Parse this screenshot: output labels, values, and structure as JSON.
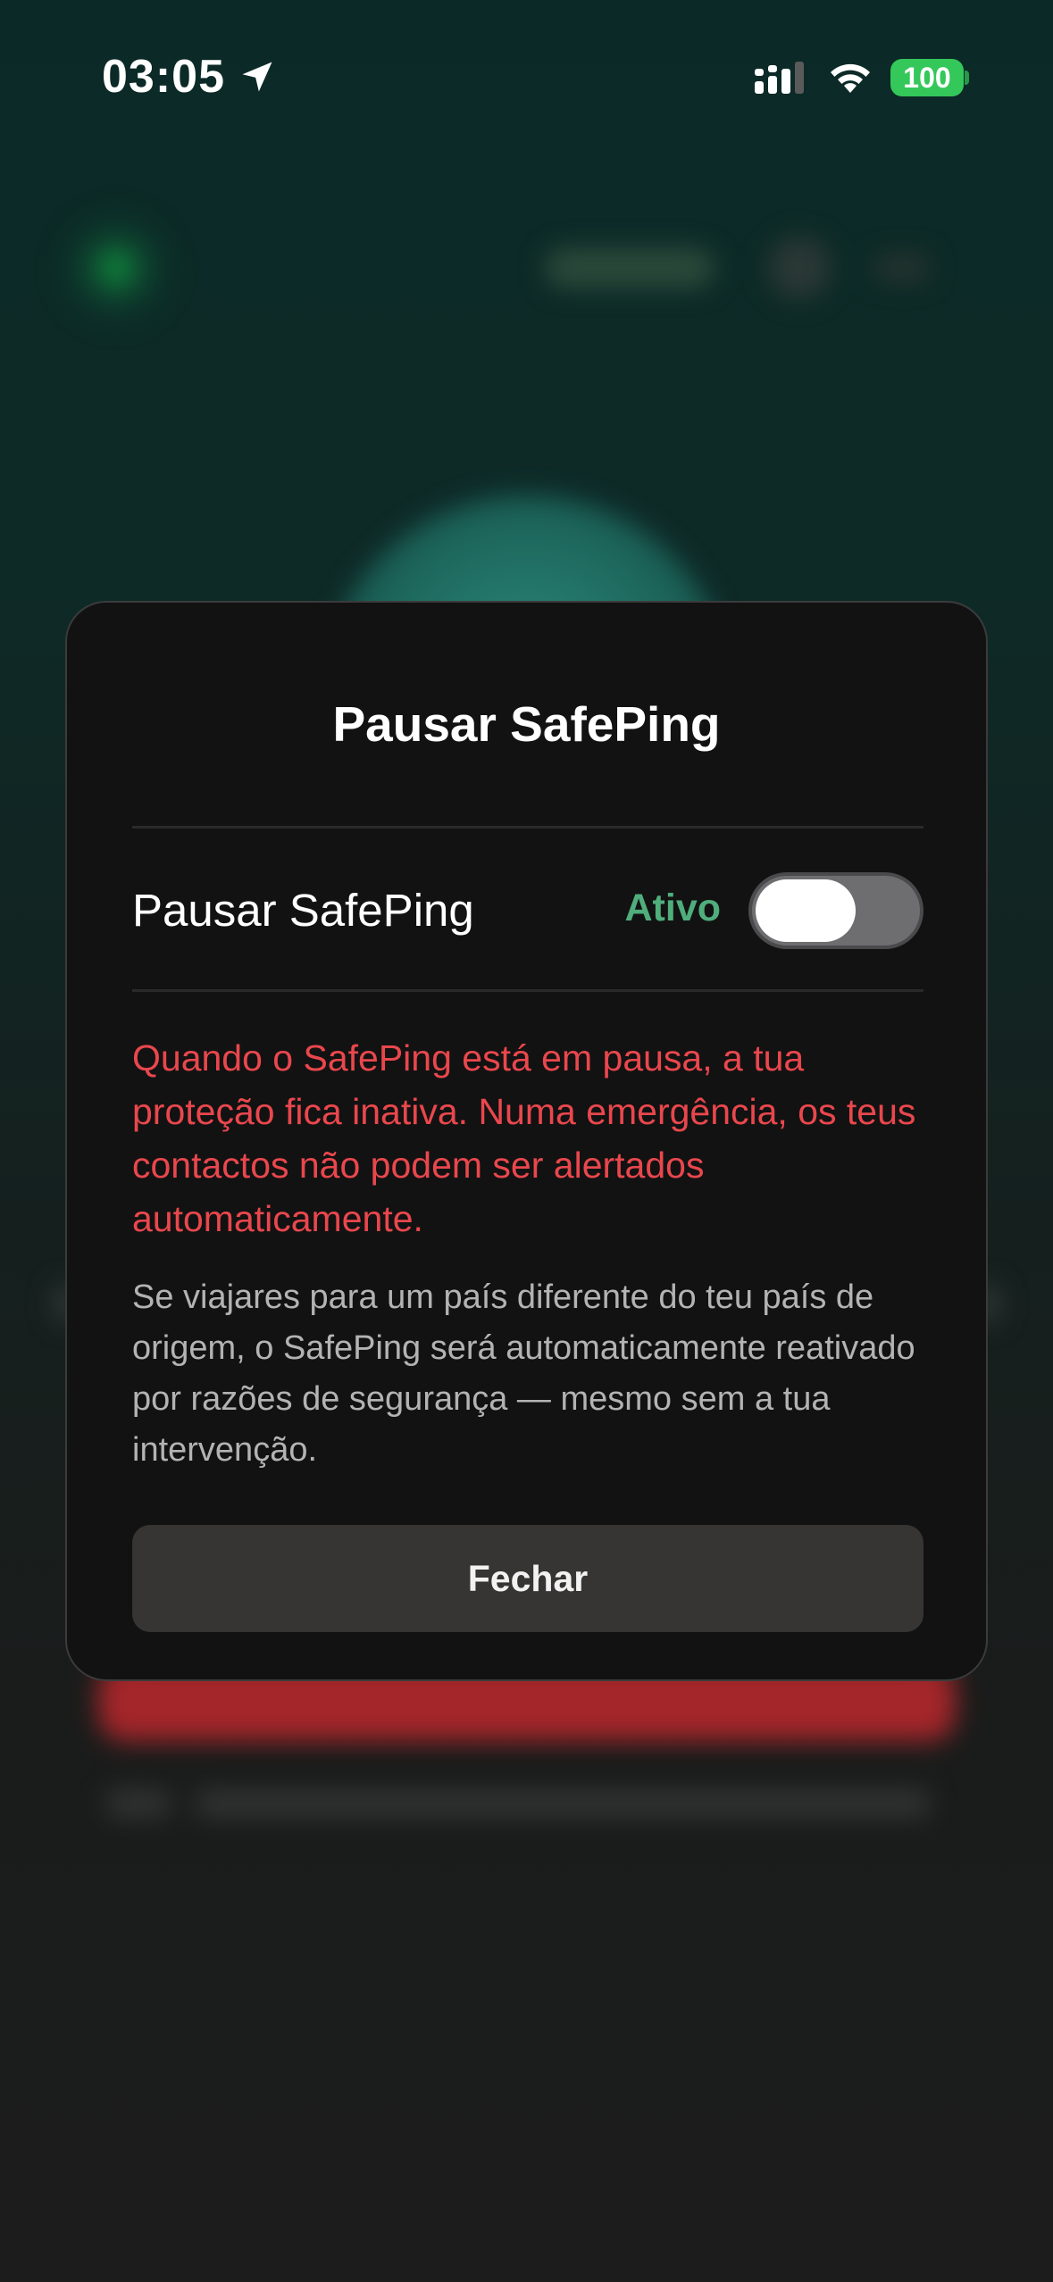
{
  "status_bar": {
    "time": "03:05",
    "battery": "100",
    "location_icon": "location-arrow-icon",
    "signal_icon": "cellular-signal-icon",
    "wifi_icon": "wifi-icon"
  },
  "modal": {
    "title": "Pausar SafePing",
    "toggle_label": "Pausar SafePing",
    "toggle_status": "Ativo",
    "toggle_on": false,
    "warning": "Quando o SafePing está em pausa, a tua proteção fica inativa. Numa emergência, os teus contactos não podem ser alertados automaticamente.",
    "info": "Se viajares para um país diferente do teu país de origem, o SafePing será automaticamente reativado por razões de segurança — mesmo sem a tua intervenção.",
    "close_label": "Fechar"
  },
  "colors": {
    "accent_green": "#4fae7c",
    "warning_red": "#e9474d",
    "battery_green": "#34c759",
    "modal_bg": "#121212",
    "button_bg": "#363534"
  }
}
